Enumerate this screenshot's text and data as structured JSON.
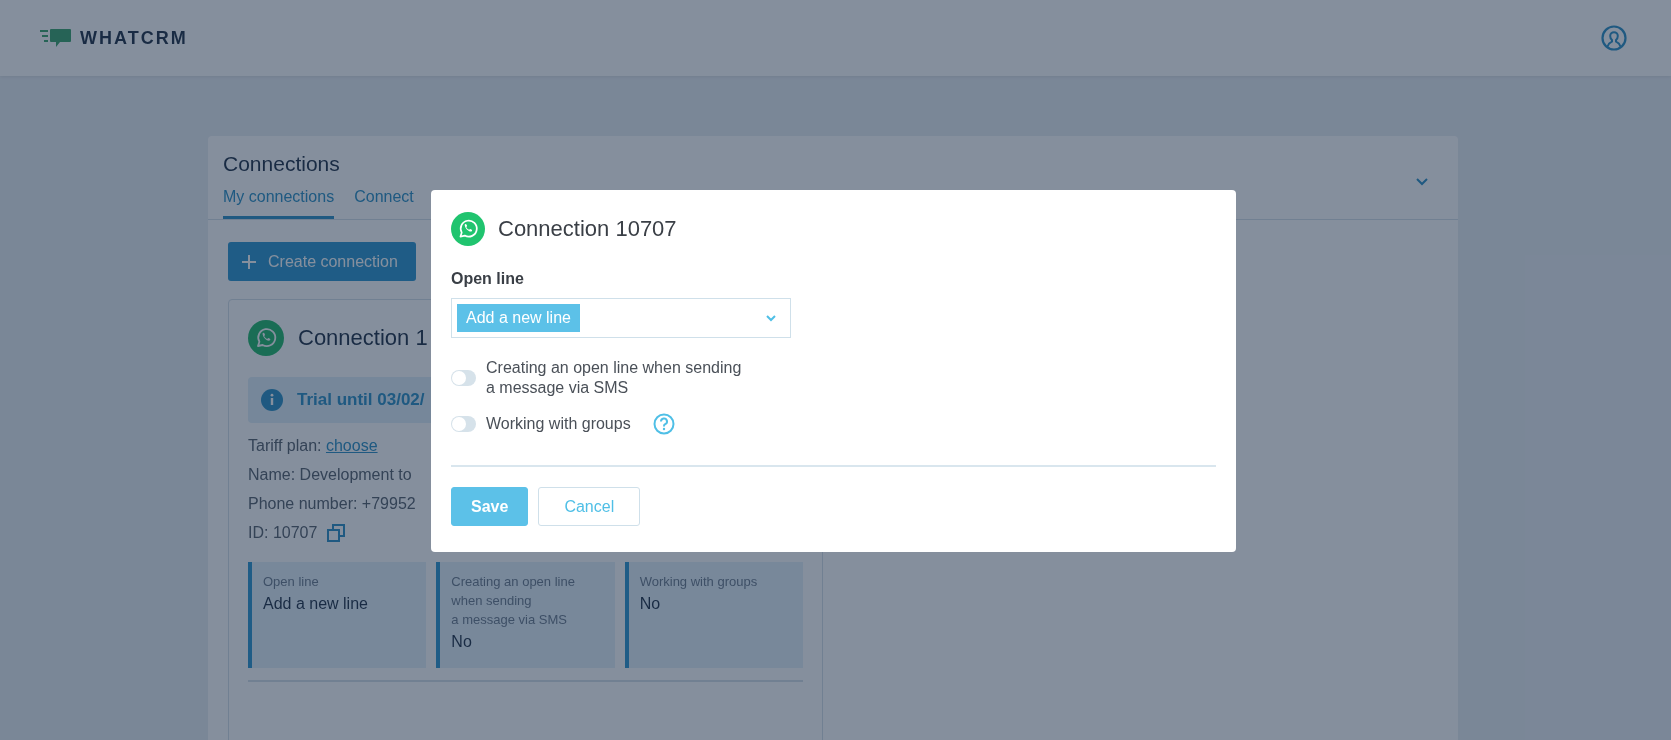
{
  "header": {
    "logo": "WHATCRM"
  },
  "page": {
    "title": "Connections",
    "tabs": [
      {
        "label": "My connections",
        "selected": true
      },
      {
        "label": "Connect",
        "selected": false
      }
    ],
    "create_button": "Create connection",
    "connection_card": {
      "title": "Connection 1",
      "notice": "Trial until 03/02/",
      "details": [
        {
          "kind": "link",
          "text": "Tariff plan: ",
          "link": "choose"
        },
        {
          "kind": "text",
          "text": "Name: Development to"
        },
        {
          "kind": "text",
          "text": "Phone number: +79952"
        },
        {
          "kind": "id",
          "text": "ID: 10707"
        }
      ],
      "settings": [
        {
          "label": "Open line",
          "value": "Add a new line"
        },
        {
          "label": "Creating an open line\nwhen sending\na message via SMS",
          "value": "No"
        },
        {
          "label": "Working with groups",
          "value": "No"
        }
      ]
    }
  },
  "modal": {
    "title": "Connection 10707",
    "field_label": "Open line",
    "select": {
      "value": "Add a new line"
    },
    "toggles": [
      {
        "label": "Creating an open line when sending\na message via SMS",
        "on": false,
        "help": false
      },
      {
        "label": "Working with groups",
        "on": false,
        "help": true
      }
    ],
    "buttons": [
      {
        "label": "Save",
        "kind": "primary"
      },
      {
        "label": "Cancel",
        "kind": "secondary"
      }
    ]
  }
}
